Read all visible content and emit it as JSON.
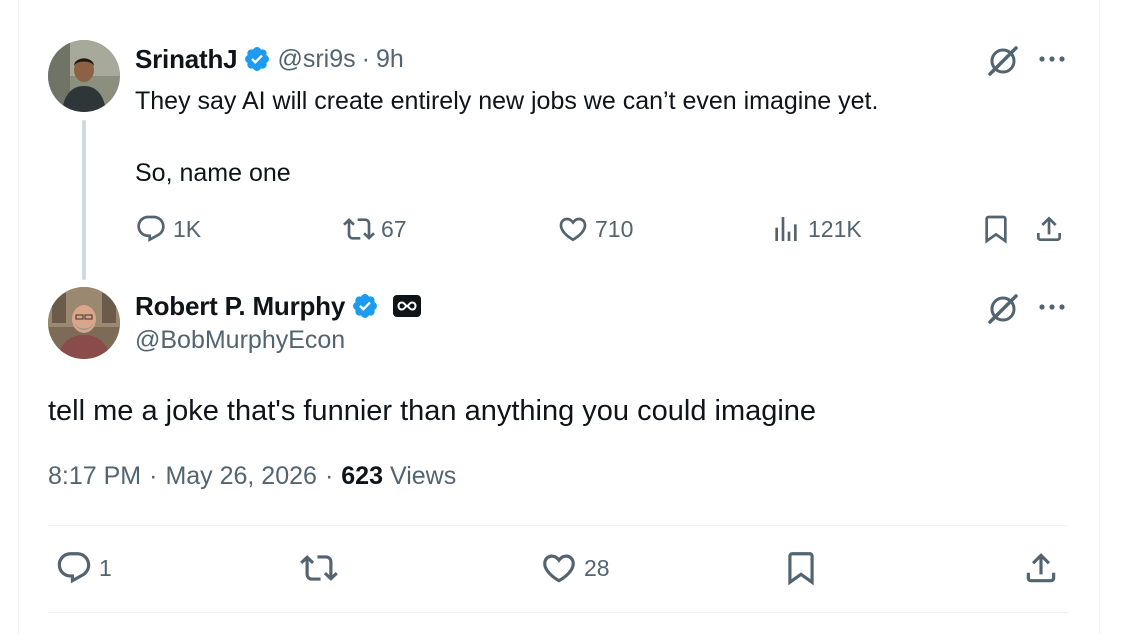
{
  "parent_tweet": {
    "display_name": "SrinathJ",
    "handle": "@sri9s",
    "separator": "·",
    "time": "9h",
    "text_line1": "They say AI will create entirely new jobs we can’t even imagine yet.",
    "text_line2": "So, name one",
    "replies": "1K",
    "retweets": "67",
    "likes": "710",
    "views": "121K"
  },
  "main_tweet": {
    "display_name": "Robert P. Murphy",
    "handle": "@BobMurphyEcon",
    "text": "tell me a joke that's funnier than anything you could imagine",
    "timestamp": "8:17 PM",
    "separator": "·",
    "date": "May 26, 2026",
    "views_count": "623",
    "views_label": "Views",
    "replies": "1",
    "likes": "28"
  },
  "icons": {
    "verified": "verified-badge-icon",
    "affiliate": "infinity-badge-icon",
    "grok": "grok-icon",
    "more": "more-icon",
    "reply": "reply-icon",
    "retweet": "retweet-icon",
    "like": "heart-icon",
    "views": "analytics-icon",
    "bookmark": "bookmark-icon",
    "share": "share-icon"
  },
  "colors": {
    "verified_blue": "#1d9bf0",
    "text_primary": "#0f1419",
    "text_secondary": "#536471",
    "thread_line": "#cfd9de",
    "divider": "#eff3f4"
  }
}
